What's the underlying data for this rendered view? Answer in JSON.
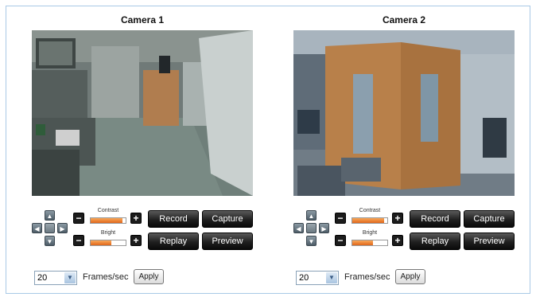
{
  "cameras": [
    {
      "title": "Camera 1",
      "contrast": {
        "label": "Contrast",
        "level_percent": 90
      },
      "bright": {
        "label": "Bright",
        "level_percent": 60
      },
      "buttons": {
        "record": "Record",
        "capture": "Capture",
        "replay": "Replay",
        "preview": "Preview"
      },
      "frame_rate": {
        "value": "20",
        "label": "Frames/sec",
        "apply": "Apply"
      }
    },
    {
      "title": "Camera 2",
      "contrast": {
        "label": "Contrast",
        "level_percent": 90
      },
      "bright": {
        "label": "Bright",
        "level_percent": 60
      },
      "buttons": {
        "record": "Record",
        "capture": "Capture",
        "replay": "Replay",
        "preview": "Preview"
      },
      "frame_rate": {
        "value": "20",
        "label": "Frames/sec",
        "apply": "Apply"
      }
    }
  ],
  "colors": {
    "border": "#a9c9e6",
    "slider_fill": "#e0661a",
    "button_bg": "#1f1f1f"
  }
}
